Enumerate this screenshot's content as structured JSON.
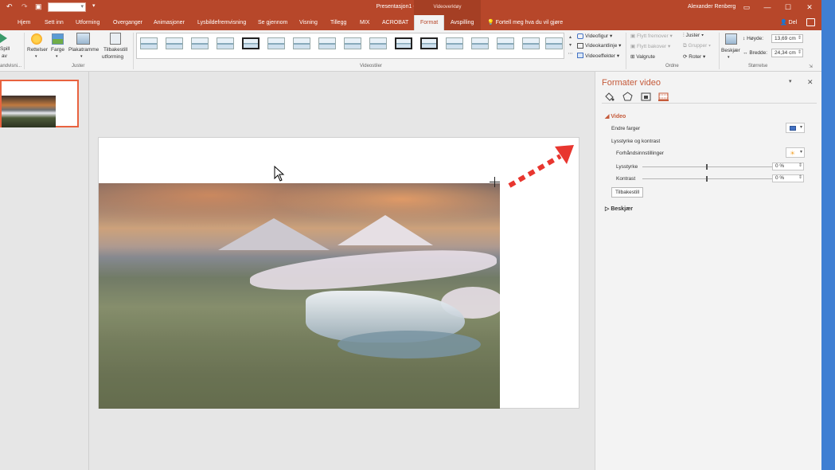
{
  "titlebar": {
    "title": "Presentasjon1 - PowerPoint",
    "context_group": "Videoverktøy",
    "user": "Alexander Renberg",
    "undo_icon": "undo-icon",
    "redo_icon": "redo-icon"
  },
  "tabs": [
    "Hjem",
    "Sett inn",
    "Utforming",
    "Overganger",
    "Animasjoner",
    "Lysbildefremvisning",
    "Se gjennom",
    "Visning",
    "Tillegg",
    "MIX",
    "ACROBAT",
    "Format",
    "Avspilling"
  ],
  "active_tab": "Format",
  "tellme": "Fortell meg hva du vil gjøre",
  "share": "Del",
  "ribbon": {
    "play_label1": "Spill",
    "play_label2": "av",
    "preview_group": "andvisni...",
    "adjust": {
      "corrections": "Rettelser",
      "color": "Farge",
      "poster_frame": "Plakatramme",
      "reset_design1": "Tilbakestill",
      "reset_design2": "utforming",
      "group_label": "Juster"
    },
    "video_styles_group": "Videostiler",
    "style_cmds": {
      "shape": "Videofigur",
      "border": "Videokantlinje",
      "effects": "Videoeffekter"
    },
    "arrange": {
      "bring_forward": "Flytt fremover",
      "send_backward": "Flytt bakover",
      "selection_pane": "Valgrute",
      "align": "Juster",
      "group": "Grupper",
      "rotate": "Roter",
      "group_label": "Ordne"
    },
    "size": {
      "crop": "Beskjær",
      "height_label": "Høyde:",
      "height_value": "13,69 cm",
      "width_label": "Bredde:",
      "width_value": "24,34 cm",
      "group_label": "Størrelse"
    }
  },
  "pane": {
    "title": "Formater video",
    "section_video": "Video",
    "recolor": "Endre farger",
    "brightness_contrast": "Lysstyrke og kontrast",
    "presets": "Forhåndsinnstillinger",
    "brightness": "Lysstyrke",
    "brightness_value": "0 %",
    "contrast": "Kontrast",
    "contrast_value": "0 %",
    "reset": "Tilbakestill",
    "section_crop": "Beskjær"
  }
}
